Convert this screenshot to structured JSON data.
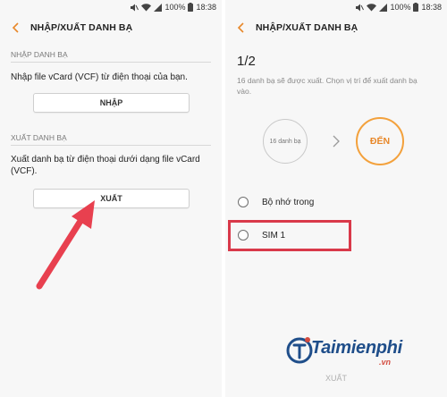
{
  "status_bar": {
    "battery": "100%",
    "time": "18:38"
  },
  "left_screen": {
    "title": "NHẬP/XUẤT DANH BẠ",
    "import_section": {
      "header": "NHẬP DANH BẠ",
      "description": "Nhập file vCard (VCF) từ điện thoại của bạn.",
      "button_label": "NHẬP"
    },
    "export_section": {
      "header": "XUẤT DANH BẠ",
      "description_line1": "Xuất danh bạ từ điện thoại dưới dạng file vCard",
      "description_line2": "(VCF).",
      "button_label": "XUẤT"
    }
  },
  "right_screen": {
    "title": "NHẬP/XUẤT DANH BẠ",
    "step": "1/2",
    "hint_line1": "16 danh bạ sẽ được xuất. Chọn vị trí để xuất danh bạ",
    "hint_line2": "vào.",
    "source_label": "16 danh bạ",
    "destination_label": "ĐẾN",
    "options": [
      {
        "label": "Bộ nhớ trong"
      },
      {
        "label": "SIM 1"
      }
    ],
    "bottom_button": "XUẤT"
  },
  "watermark": {
    "brand": "Taimienphi",
    "suffix": ".vn"
  },
  "colors": {
    "accent_orange": "#f3a13c",
    "highlight_red": "#d9394a",
    "annotation_arrow": "#e8404f",
    "watermark_blue": "#1f4e8a"
  }
}
